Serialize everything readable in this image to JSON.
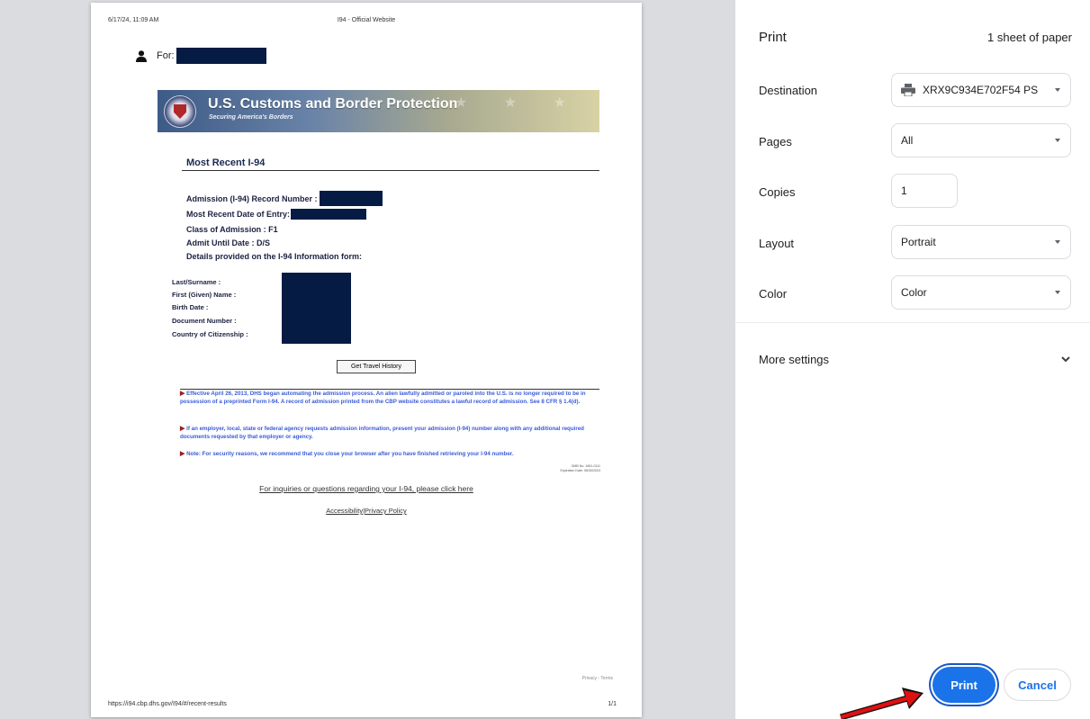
{
  "preview": {
    "header_date": "6/17/24, 11:09 AM",
    "header_site": "I94 - Official Website",
    "footer_url": "https://i94.cbp.dhs.gov/I94/#/recent-results",
    "footer_page": "1/1",
    "for_label": "For:",
    "banner_title": "U.S. Customs and Border Protection",
    "banner_subtitle": "Securing America's Borders",
    "section_title": "Most Recent I-94",
    "record_number_label": "Admission (I-94) Record Number :",
    "entry_date_label": "Most Recent Date of Entry:",
    "class_of_admission": "Class of Admission : F1",
    "admit_until": "Admit Until Date : D/S",
    "details_label": "Details provided on the I-94 Information form:",
    "details": {
      "surname": "Last/Surname :",
      "given_name": "First (Given) Name :",
      "birth_date": "Birth Date :",
      "document_number": "Document Number :",
      "citizenship": "Country of Citizenship :"
    },
    "travel_history_button": "Get Travel History",
    "notices": [
      "Effective April 26, 2013, DHS began automating the admission process. An alien lawfully admitted or paroled into the U.S. is no longer required to be in possession of a preprinted Form I-94. A record of admission printed from the CBP website constitutes a lawful record of admission. See 8 CFR § 1.4(d).",
      "If an employer, local, state or federal agency requests admission information, present your admission (I-94) number along with any additional required documents requested by that employer or agency.",
      "Note: For security reasons, we recommend that you close your browser after you have finished retrieving your I-94 number."
    ],
    "omb_line1": "OMB No. 1651-0111",
    "omb_line2": "Expiration Date: 06/30/2024",
    "inquiry_link": "For inquiries or questions regarding your I-94, please click here",
    "accessibility_link": "Accessibility",
    "link_separator": "|",
    "privacy_link": "Privacy Policy",
    "privacy_terms": "Privacy - Terms"
  },
  "panel": {
    "title": "Print",
    "sheets": "1 sheet of paper",
    "destination_label": "Destination",
    "destination_value": "XRX9C934E702F54 PS",
    "pages_label": "Pages",
    "pages_value": "All",
    "copies_label": "Copies",
    "copies_value": "1",
    "layout_label": "Layout",
    "layout_value": "Portrait",
    "color_label": "Color",
    "color_value": "Color",
    "more_settings": "More settings",
    "print_button": "Print",
    "cancel_button": "Cancel"
  },
  "colors": {
    "accent": "#1a73e8",
    "redaction": "#061b43",
    "notice_text": "#3a5bd9",
    "annotation_arrow": "#e01010"
  },
  "icons": [
    "person-icon",
    "printer-icon",
    "caret-down-icon",
    "chevron-down-icon",
    "red-arrow-annotation"
  ]
}
